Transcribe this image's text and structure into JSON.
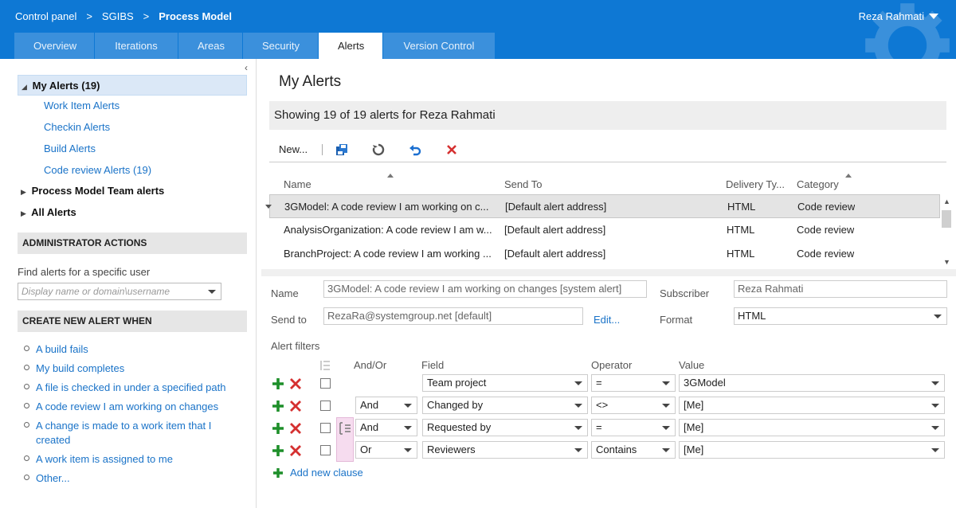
{
  "header": {
    "breadcrumb": [
      "Control panel",
      ">",
      "SGIBS",
      ">",
      "Process Model"
    ],
    "user": "Reza Rahmati"
  },
  "tabs": [
    "Overview",
    "Iterations",
    "Areas",
    "Security",
    "Alerts",
    "Version Control"
  ],
  "active_tab": "Alerts",
  "sidebar": {
    "tree": {
      "my_alerts": "My Alerts (19)",
      "children": [
        "Work Item Alerts",
        "Checkin Alerts",
        "Build Alerts",
        "Code review Alerts (19)"
      ],
      "team_alerts": "Process Model Team alerts",
      "all_alerts": "All Alerts"
    },
    "admin_header": "ADMINISTRATOR ACTIONS",
    "find_label": "Find alerts for a specific user",
    "find_placeholder": "Display name or domain\\username",
    "create_header": "CREATE NEW ALERT WHEN",
    "create_items": [
      "A build fails",
      "My build completes",
      "A file is checked in under a specified path",
      "A code review I am working on changes",
      "A change is made to a work item that I created",
      "A work item is assigned to me",
      "Other..."
    ]
  },
  "main": {
    "title": "My Alerts",
    "showing": "Showing 19 of 19 alerts for Reza Rahmati",
    "toolbar": {
      "new_label": "New..."
    },
    "columns": [
      "Name",
      "Send To",
      "Delivery Ty...",
      "Category"
    ],
    "rows": [
      {
        "name": "3GModel: A code review I am working on c...",
        "send_to": "[Default alert address]",
        "delivery": "HTML",
        "category": "Code review"
      },
      {
        "name": "AnalysisOrganization: A code review I am w...",
        "send_to": "[Default alert address]",
        "delivery": "HTML",
        "category": "Code review"
      },
      {
        "name": "BranchProject: A code review I am working ...",
        "send_to": "[Default alert address]",
        "delivery": "HTML",
        "category": "Code review"
      }
    ]
  },
  "details": {
    "name_label": "Name",
    "name_value": "3GModel: A code review I am working on changes [system alert]",
    "subscriber_label": "Subscriber",
    "subscriber_value": "Reza Rahmati",
    "send_to_label": "Send to",
    "send_to_value": "RezaRa@systemgroup.net [default]",
    "edit_label": "Edit...",
    "format_label": "Format",
    "format_value": "HTML",
    "filters_label": "Alert filters",
    "filter_headers": {
      "andor": "And/Or",
      "field": "Field",
      "operator": "Operator",
      "value": "Value"
    },
    "clauses": [
      {
        "andor": "",
        "field": "Team project",
        "operator": "=",
        "value": "3GModel"
      },
      {
        "andor": "And",
        "field": "Changed by",
        "operator": "<>",
        "value": "[Me]"
      },
      {
        "andor": "And",
        "field": "Requested by",
        "operator": "=",
        "value": "[Me]"
      },
      {
        "andor": "Or",
        "field": "Reviewers",
        "operator": "Contains",
        "value": "[Me]"
      }
    ],
    "add_clause": "Add new clause"
  }
}
